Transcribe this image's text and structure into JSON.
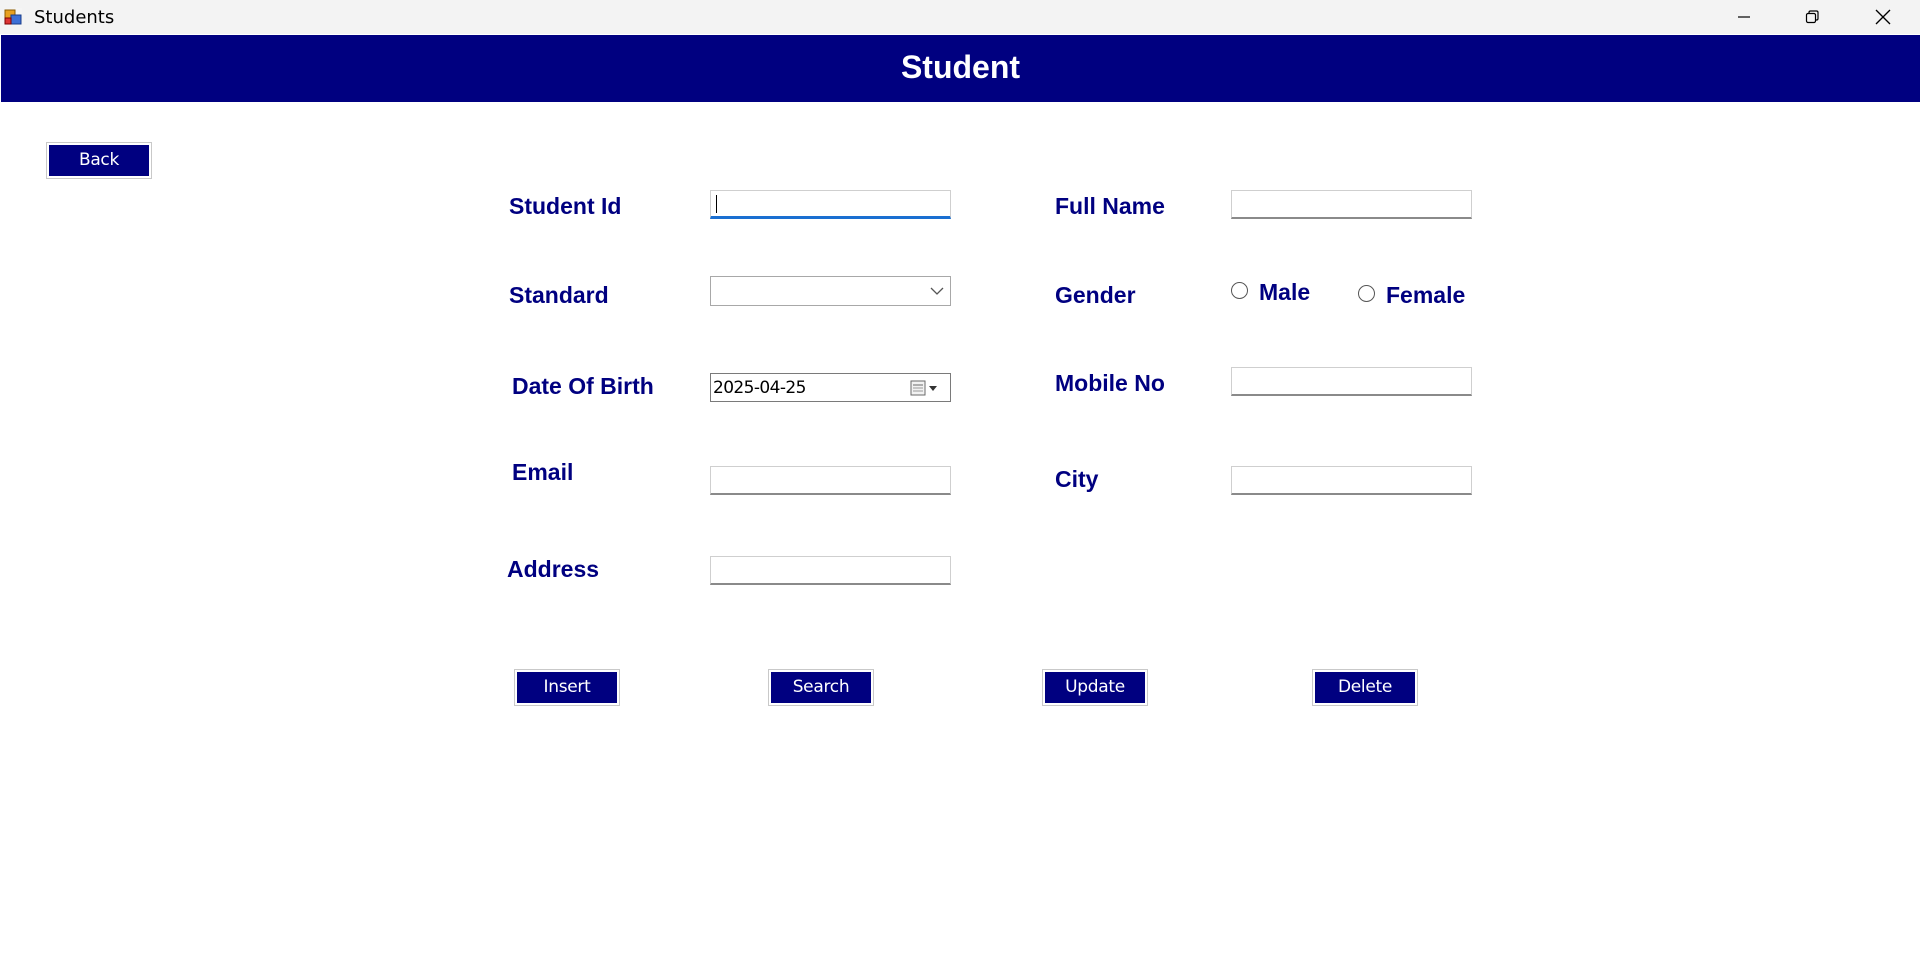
{
  "window": {
    "title": "Students",
    "controls": [
      "minimize",
      "restore",
      "close"
    ]
  },
  "header": {
    "title": "Student",
    "background": "#000080"
  },
  "back_label": "Back",
  "form": {
    "student_id": {
      "label": "Student Id",
      "value": ""
    },
    "full_name": {
      "label": "Full Name",
      "value": ""
    },
    "standard": {
      "label": "Standard",
      "value": ""
    },
    "gender": {
      "label": "Gender",
      "options": [
        "Male",
        "Female"
      ],
      "selected": ""
    },
    "dob": {
      "label": "Date Of Birth",
      "value": "2025-04-25"
    },
    "mobile": {
      "label": "Mobile No",
      "value": ""
    },
    "email": {
      "label": "Email",
      "value": ""
    },
    "city": {
      "label": "City",
      "value": ""
    },
    "address": {
      "label": "Address",
      "value": ""
    }
  },
  "actions": {
    "insert": "Insert",
    "search": "Search",
    "update": "Update",
    "delete": "Delete"
  },
  "icons": [
    "app-icon",
    "minimize-icon",
    "restore-icon",
    "close-icon",
    "chevron-down-icon",
    "calendar-icon"
  ],
  "colors": {
    "accent": "#000080",
    "focus": "#1a6fd1"
  }
}
